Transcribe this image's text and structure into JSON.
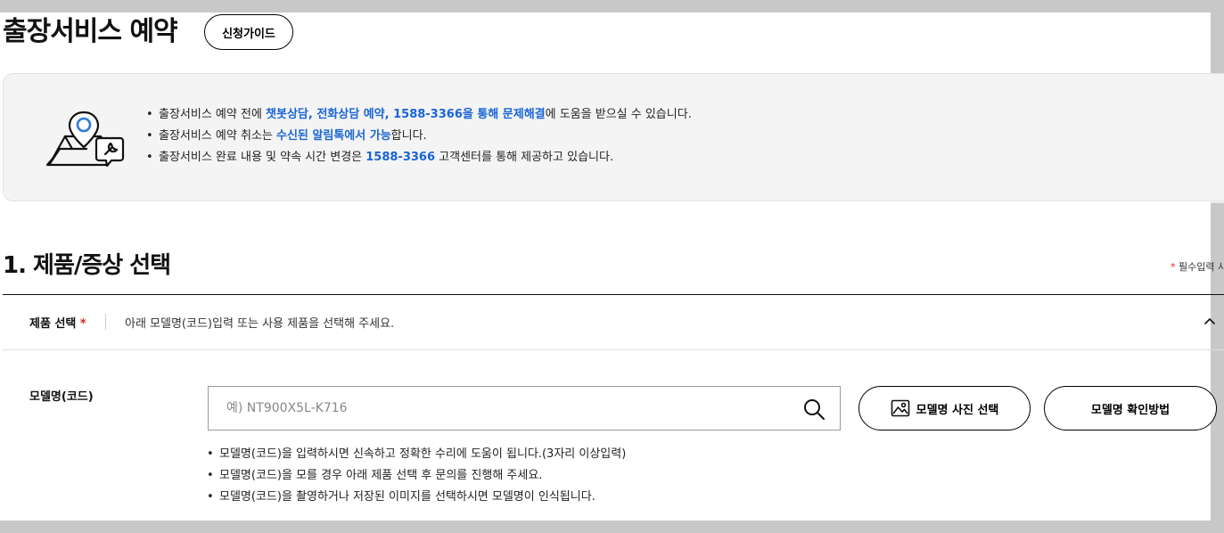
{
  "header": {
    "title": "출장서비스 예약",
    "guide_button": "신청가이드"
  },
  "notice": {
    "icon": "map-pin-repair-icon",
    "items": [
      {
        "before": "출장서비스 예약 전에 ",
        "highlight": "챗봇상담, 전화상담 예약, 1588-3366을 통해 문제해결",
        "after": "에 도움을 받으실 수 있습니다."
      },
      {
        "before": "출장서비스 예약 취소는 ",
        "highlight": "수신된 알림톡에서 가능",
        "after": "합니다."
      },
      {
        "before": "출장서비스 완료 내용 및 약속 시간 변경은 ",
        "highlight": "1588-3366",
        "after": " 고객센터를 통해 제공하고 있습니다."
      }
    ]
  },
  "section": {
    "title": "1. 제품/증상 선택",
    "required_star": "*",
    "required_text": "필수입력 사"
  },
  "product_select": {
    "label": "제품 선택",
    "star": "*",
    "description": "아래 모델명(코드)입력 또는 사용 제품을 선택해 주세요.",
    "toggle_icon": "chevron-up-icon"
  },
  "model": {
    "label": "모델명(코드)",
    "value": "",
    "placeholder": "예) NT900X5L-K716",
    "search_icon": "search-icon",
    "photo_button": "모델명 사진 선택",
    "photo_icon": "image-icon",
    "check_button": "모델명 확인방법",
    "help": [
      "모델명(코드)을 입력하시면 신속하고 정확한 수리에 도움이 됩니다.(3자리 이상입력)",
      "모델명(코드)을 모를 경우 아래 제품 선택 후 문의를 진행해 주세요.",
      "모델명(코드)을 촬영하거나 저장된 이미지를 선택하시면 모델명이 인식됩니다."
    ]
  },
  "colors": {
    "highlight": "#1a65d6",
    "required": "#e02020",
    "notice_bg": "#f4f4f4",
    "pin": "#2b7be0"
  }
}
